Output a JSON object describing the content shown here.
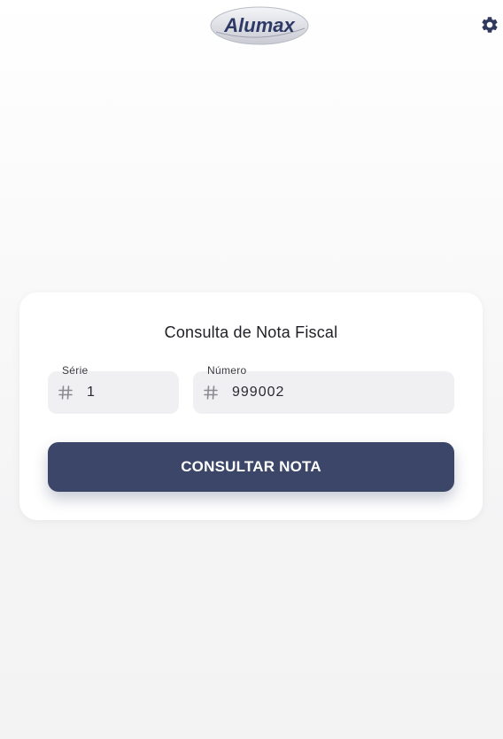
{
  "header": {
    "logo_text": "Alumax",
    "settings_icon": "gear-icon"
  },
  "card": {
    "title": "Consulta de Nota Fiscal",
    "serie": {
      "label": "Série",
      "value": "1",
      "icon": "hash-icon"
    },
    "numero": {
      "label": "Número",
      "value": "999002",
      "icon": "hash-icon"
    },
    "submit_label": "CONSULTAR NOTA"
  },
  "colors": {
    "primary": "#3b4669",
    "field_bg": "#f0f0f2",
    "icon": "#2f3a5c"
  }
}
